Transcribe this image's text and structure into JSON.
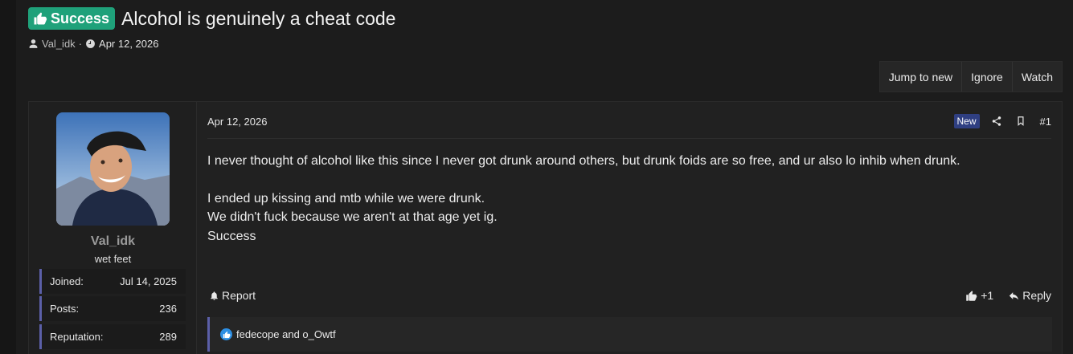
{
  "thread": {
    "prefix": "Success",
    "title": "Alcohol is genuinely a cheat code",
    "author": "Val_idk",
    "separator": "·",
    "date": "Apr 12, 2026"
  },
  "thread_actions": {
    "jump_to_new": "Jump to new",
    "ignore": "Ignore",
    "watch": "Watch"
  },
  "user": {
    "name": "Val_idk",
    "title": "wet feet",
    "stats": [
      {
        "label": "Joined:",
        "value": "Jul 14, 2025"
      },
      {
        "label": "Posts:",
        "value": "236"
      },
      {
        "label": "Reputation:",
        "value": "289"
      }
    ]
  },
  "post": {
    "date": "Apr 12, 2026",
    "badge": "New",
    "number": "#1",
    "lines": [
      "I never thought of alcohol like this since I never got drunk around others, but drunk foids are so free, and ur also lo inhib when drunk.",
      "I ended up kissing and mtb while we were drunk.",
      "We didn't fuck because we aren't at that age yet ig.",
      "Success"
    ],
    "report": "Report",
    "like_count": "+1",
    "reply": "Reply",
    "reactions_text": "fedecope and o_Owtf"
  },
  "colors": {
    "background": "#1c1c1c",
    "prefix_green": "#1fa17a",
    "new_badge": "#2f3f82",
    "accent_bar": "#5b5fa8",
    "like_blue": "#2d8fe3"
  },
  "icons": [
    "thumbs-up-icon",
    "user-icon",
    "clock-icon",
    "share-icon",
    "bookmark-icon",
    "bell-icon",
    "reply-icon"
  ]
}
